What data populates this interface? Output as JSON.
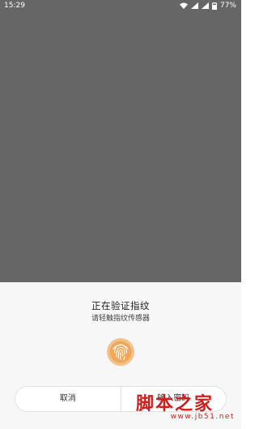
{
  "status_bar": {
    "time": "15:29",
    "battery": "77%",
    "icons": [
      "wifi-icon",
      "signal-icon",
      "signal-icon",
      "battery-icon"
    ]
  },
  "sheet": {
    "title": "正在验证指纹",
    "subtitle": "请轻触指纹传感器",
    "fingerprint_icon": "fingerprint-icon",
    "fingerprint_color": "#e8953b",
    "buttons": {
      "cancel": "取消",
      "password": "输入密码"
    }
  },
  "watermark": {
    "logo": "脚本之家",
    "url": "www.jb51.net"
  },
  "colors": {
    "dim_overlay": "#666666",
    "sheet_bg": "#f7f7f7",
    "watermark": "#d21b1b"
  }
}
